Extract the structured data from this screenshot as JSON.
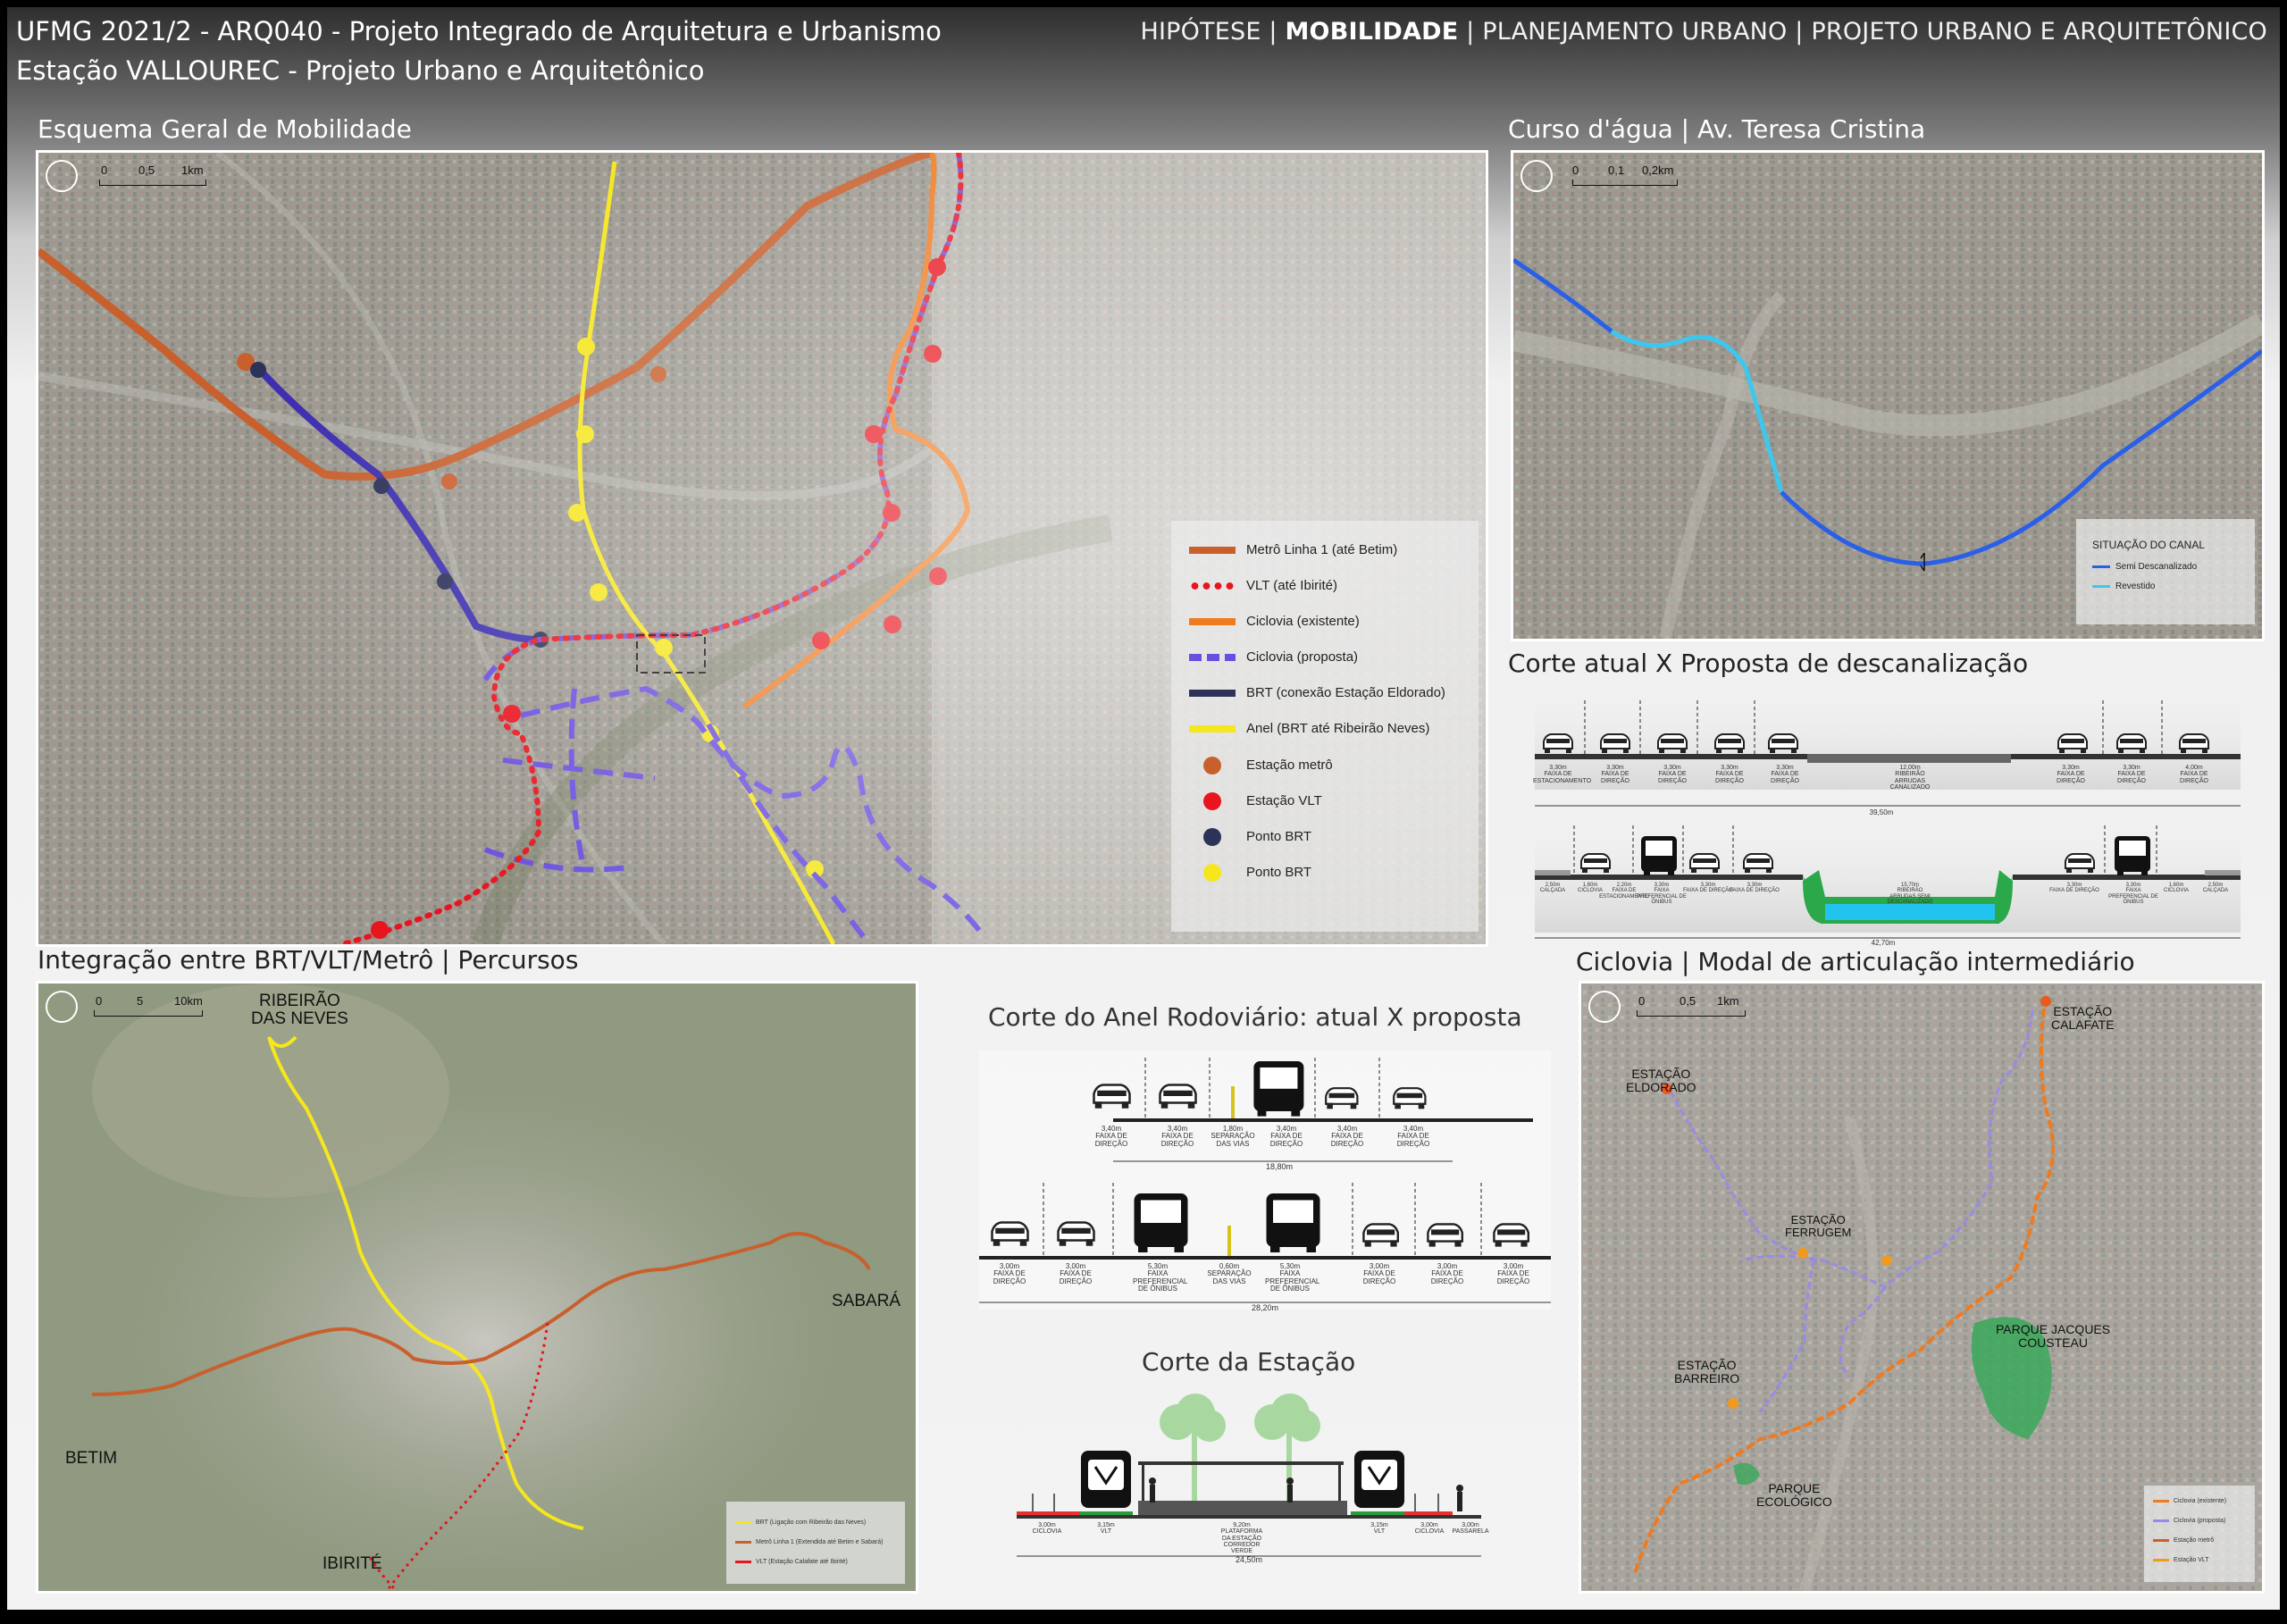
{
  "header": {
    "line1": "UFMG 2021/2 - ARQ040 - Projeto Integrado de Arquitetura e Urbanismo",
    "line2": "Estação VALLOUREC - Projeto Urbano e Arquitetônico",
    "nav": [
      {
        "label": "HIPÓTESE",
        "active": false
      },
      {
        "label": "MOBILIDADE",
        "active": true
      },
      {
        "label": "PLANEJAMENTO URBANO",
        "active": false
      },
      {
        "label": "PROJETO URBANO E ARQUITETÔNICO",
        "active": false
      }
    ],
    "separator": " | "
  },
  "sections": {
    "mobility_scheme": "Esquema Geral de Mobilidade",
    "watercourse": "Curso d'água | Av. Teresa Cristina",
    "canal_section": "Corte atual X Proposta de descanalização",
    "integration": "Integração entre BRT/VLT/Metrô | Percursos",
    "ring_road": "Corte do Anel Rodoviário: atual X proposta",
    "station_section": "Corte da Estação",
    "bike": "Ciclovia | Modal de articulação intermediário"
  },
  "scales": {
    "main": [
      "0",
      "0,5",
      "1km"
    ],
    "water": [
      "0",
      "0,1",
      "0,2km"
    ],
    "integration": [
      "0",
      "5",
      "10km"
    ],
    "bike": [
      "0",
      "0,5",
      "1km"
    ]
  },
  "main_legend": [
    {
      "label": "Metrô Linha 1 (até Betim)",
      "color": "#c8602e",
      "style": "line"
    },
    {
      "label": "VLT (até Ibirité)",
      "color": "#e8141e",
      "style": "dots"
    },
    {
      "label": "Ciclovia (existente)",
      "color": "#f07a1e",
      "style": "line"
    },
    {
      "label": "Ciclovia (proposta)",
      "color": "#6a4ee0",
      "style": "dash"
    },
    {
      "label": "BRT (conexão Estação Eldorado)",
      "color": "#2d3258",
      "style": "line"
    },
    {
      "label": "Anel (BRT até Ribeirão Neves)",
      "color": "#f5e61e",
      "style": "line"
    },
    {
      "label": "Estação metrô",
      "color": "#c8602e",
      "style": "dot"
    },
    {
      "label": "Estação VLT",
      "color": "#e8141e",
      "style": "dot"
    },
    {
      "label": "Ponto BRT",
      "color": "#2d3258",
      "style": "dot"
    },
    {
      "label": "Ponto BRT",
      "color": "#f5e61e",
      "style": "dot"
    }
  ],
  "water_legend": {
    "title": "SITUAÇÃO DO CANAL",
    "items": [
      {
        "label": "Semi Descanalizado",
        "color": "#2a5fe8"
      },
      {
        "label": "Revestido",
        "color": "#3cc8ee"
      }
    ]
  },
  "canal_current": {
    "dims": [
      {
        "v": "3,30m",
        "l": "FAIXA DE ESTACIONAMENTO"
      },
      {
        "v": "3,30m",
        "l": "FAIXA DE DIREÇÃO"
      },
      {
        "v": "3,30m",
        "l": "FAIXA DE DIREÇÃO"
      },
      {
        "v": "3,30m",
        "l": "FAIXA DE DIREÇÃO"
      },
      {
        "v": "3,30m",
        "l": "FAIXA DE DIREÇÃO"
      },
      {
        "v": "12,00m",
        "l": "RIBEIRÃO ARRUDAS CANALIZADO"
      },
      {
        "v": "3,30m",
        "l": "FAIXA DE DIREÇÃO"
      },
      {
        "v": "3,30m",
        "l": "FAIXA DE DIREÇÃO"
      },
      {
        "v": "4,00m",
        "l": "FAIXA DE DIREÇÃO"
      }
    ],
    "total": "39,50m"
  },
  "canal_proposed": {
    "dims": [
      {
        "v": "2,50m",
        "l": "CALÇADA"
      },
      {
        "v": "1,60m",
        "l": "CICLOVIA"
      },
      {
        "v": "2,20m",
        "l": "FAIXA DE ESTACIONAMENTO"
      },
      {
        "v": "3,30m",
        "l": "FAIXA PREFERENCIAL DE ÔNIBUS"
      },
      {
        "v": "3,30m",
        "l": "FAIXA DE DIREÇÃO"
      },
      {
        "v": "3,30m",
        "l": "FAIXA DE DIREÇÃO"
      },
      {
        "v": "15,70m",
        "l": "RIBEIRÃO ARRUDAS SEMI DESCANALIZADO"
      },
      {
        "v": "3,30m",
        "l": "FAIXA DE DIREÇÃO"
      },
      {
        "v": "3,30m",
        "l": "FAIXA PREFERENCIAL DE ÔNIBUS"
      },
      {
        "v": "1,60m",
        "l": "CICLOVIA"
      },
      {
        "v": "2,50m",
        "l": "CALÇADA"
      }
    ],
    "total": "42,70m"
  },
  "ring_current": {
    "dims": [
      {
        "v": "3,40m",
        "l": "FAIXA DE DIREÇÃO"
      },
      {
        "v": "3,40m",
        "l": "FAIXA DE DIREÇÃO"
      },
      {
        "v": "1,80m",
        "l": "SEPARAÇÃO DAS VIAS"
      },
      {
        "v": "3,40m",
        "l": "FAIXA DE DIREÇÃO"
      },
      {
        "v": "3,40m",
        "l": "FAIXA DE DIREÇÃO"
      },
      {
        "v": "3,40m",
        "l": "FAIXA DE DIREÇÃO"
      }
    ],
    "total": "18,80m"
  },
  "ring_proposed": {
    "dims": [
      {
        "v": "3,00m",
        "l": "FAIXA DE DIREÇÃO"
      },
      {
        "v": "3,00m",
        "l": "FAIXA DE DIREÇÃO"
      },
      {
        "v": "5,30m",
        "l": "FAIXA PREFERENCIAL DE ÔNIBUS"
      },
      {
        "v": "0,60m",
        "l": "SEPARAÇÃO DAS VIAS"
      },
      {
        "v": "5,30m",
        "l": "FAIXA PREFERENCIAL DE ÔNIBUS"
      },
      {
        "v": "3,00m",
        "l": "FAIXA DE DIREÇÃO"
      },
      {
        "v": "3,00m",
        "l": "FAIXA DE DIREÇÃO"
      },
      {
        "v": "3,00m",
        "l": "FAIXA DE DIREÇÃO"
      }
    ],
    "total": "28,20m"
  },
  "station": {
    "dims": [
      {
        "v": "3,00m",
        "l": "CICLOVIA"
      },
      {
        "v": "3,15m",
        "l": "VLT"
      },
      {
        "v": "9,20m",
        "l": "PLATAFORMA DA ESTAÇÃO CORREDOR VERDE"
      },
      {
        "v": "3,15m",
        "l": "VLT"
      },
      {
        "v": "3,00m",
        "l": "CICLOVIA"
      },
      {
        "v": "3,00m",
        "l": "PASSARELA"
      }
    ],
    "total": "24,50m"
  },
  "integration_labels": {
    "ribeirao": "RIBEIRÃO\nDAS NEVES",
    "sabara": "SABARÁ",
    "betim": "BETIM",
    "ibirite": "IBIRITÉ"
  },
  "integration_legend": [
    {
      "label": "BRT (Ligação com Ribeirão das Neves)",
      "color": "#f5e61e"
    },
    {
      "label": "Metrô Linha 1 (Extendida até Betim e Sabará)",
      "color": "#c8602e"
    },
    {
      "label": "VLT (Estação Calafate até Ibirité)",
      "color": "#e8141e"
    }
  ],
  "bike_labels": {
    "calafate": "ESTAÇÃO\nCALAFATE",
    "eldorado": "ESTAÇÃO\nELDORADO",
    "ferrugem": "ESTAÇÃO\nFERRUGEM",
    "barreiro": "ESTAÇÃO\nBARREIRO",
    "cousteau": "PARQUE JACQUES\nCOUSTEAU",
    "ecologico": "PARQUE\nECOLÓGICO"
  },
  "bike_legend": [
    {
      "label": "Ciclovia (existente)",
      "color": "#f07a1e"
    },
    {
      "label": "Ciclovia (proposta)",
      "color": "#9a8ae8"
    },
    {
      "label": "Estação metrô",
      "color": "#c8602e"
    },
    {
      "label": "Estação VLT",
      "color": "#f09a1e"
    }
  ]
}
